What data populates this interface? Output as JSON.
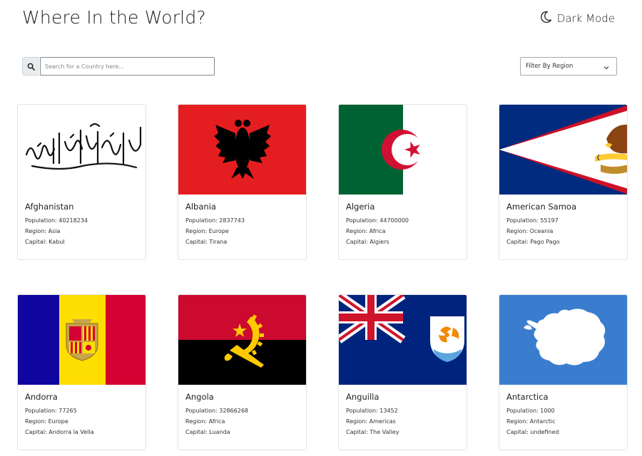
{
  "header": {
    "title": "Where In the World?",
    "dark_mode_label": "Dark Mode",
    "dark_mode_icon": "moon-icon"
  },
  "search": {
    "placeholder": "Search for a Country here...",
    "value": "",
    "icon": "search-icon"
  },
  "filter": {
    "label": "Filter By Region",
    "icon": "chevron-down-icon"
  },
  "labels": {
    "population": "Population: ",
    "region": "Region: ",
    "capital": "Capital: "
  },
  "countries": [
    {
      "name": "Afghanistan",
      "population": "40218234",
      "region": "Asia",
      "capital": "Kabul",
      "flag": "afghanistan-flag"
    },
    {
      "name": "Albania",
      "population": "2837743",
      "region": "Europe",
      "capital": "Tirana",
      "flag": "albania-flag"
    },
    {
      "name": "Algeria",
      "population": "44700000",
      "region": "Africa",
      "capital": "Algiers",
      "flag": "algeria-flag"
    },
    {
      "name": "American Samoa",
      "population": "55197",
      "region": "Oceania",
      "capital": "Pago Pago",
      "flag": "american-samoa-flag"
    },
    {
      "name": "Andorra",
      "population": "77265",
      "region": "Europe",
      "capital": "Andorra la Vella",
      "flag": "andorra-flag"
    },
    {
      "name": "Angola",
      "population": "32866268",
      "region": "Africa",
      "capital": "Luanda",
      "flag": "angola-flag"
    },
    {
      "name": "Anguilla",
      "population": "13452",
      "region": "Americas",
      "capital": "The Valley",
      "flag": "anguilla-flag"
    },
    {
      "name": "Antarctica",
      "population": "1000",
      "region": "Antarctic",
      "capital": "undefined",
      "flag": "antarctica-flag"
    }
  ],
  "colors": {
    "text": "#222222",
    "card_border": "#e3e3e3",
    "albania_red": "#e41e20",
    "algeria_green": "#006233",
    "algeria_red": "#d21034",
    "samoa_blue": "#002b7f",
    "samoa_red": "#ce1126",
    "andorra_blue": "#10069f",
    "andorra_yellow": "#fedd00",
    "andorra_red": "#d50032",
    "angola_red": "#cc092f",
    "angola_yellow": "#ffcb00",
    "anguilla_blue": "#00247d",
    "antarctica_blue": "#3a7dce"
  }
}
